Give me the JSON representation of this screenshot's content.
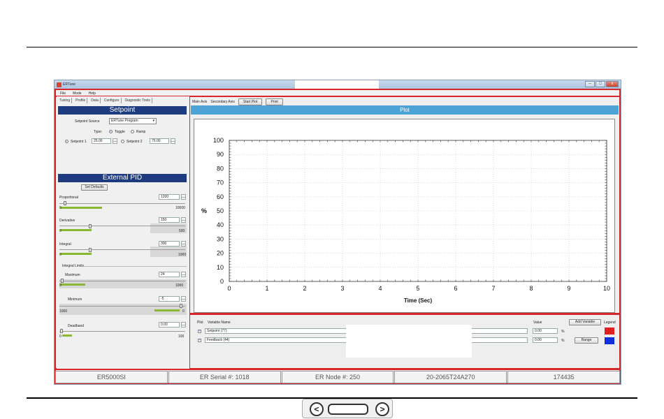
{
  "window": {
    "title": "ERTune",
    "min": "–",
    "max": "□",
    "close": "x"
  },
  "menu": [
    "File",
    "Mode",
    "Help"
  ],
  "tabs": [
    "Tuning",
    "Profile",
    "Data",
    "Configure",
    "Diagnostic Tools"
  ],
  "setpoint": {
    "heading": "Setpoint",
    "source_label": "Setpoint Source",
    "source_value": "ERTune Program",
    "type_label": "Type:",
    "type_options": [
      "Toggle",
      "Ramp"
    ],
    "sp1_label": "Setpoint 1",
    "sp1_value": "25.00",
    "sp2_label": "Setpoint 2",
    "sp2_value": "75.00"
  },
  "external_pid": {
    "heading": "External PID",
    "set_defaults": "Set Defaults",
    "proportional": {
      "label": "Proportional",
      "value": "1200",
      "min": "0",
      "max": "10000",
      "level": 0.12
    },
    "derivative": {
      "label": "Derivative",
      "value": "150",
      "min": "0",
      "max": "500",
      "level": 0.3
    },
    "integral": {
      "label": "Integral",
      "value": "300",
      "min": "0",
      "max": "1000",
      "level": 0.3
    },
    "integral_limits_label": "Integral Limits",
    "maximum": {
      "label": "Maximum",
      "value": "24",
      "min": "0",
      "max": "1000",
      "level": 0.024
    },
    "minimum": {
      "label": "Minimum",
      "value": "-5",
      "min": "1000",
      "max": "0",
      "level": 0.995
    },
    "deadband": {
      "label": "Deadband",
      "value": "0.00",
      "min": "0",
      "max": "100",
      "level": 0.0
    }
  },
  "toolbar": {
    "main_axis": "Main Axis",
    "secondary_axis": "Secondary Axis",
    "start_plot": "Start Plot",
    "print": "Print"
  },
  "plot_header": "Plot",
  "chart_data": {
    "type": "line",
    "xlabel": "Time (Sec)",
    "ylabel": "%",
    "xlim": [
      0,
      10
    ],
    "ylim": [
      0,
      100
    ],
    "xticks": [
      0,
      1,
      2,
      3,
      4,
      5,
      6,
      7,
      8,
      9,
      10
    ],
    "yticks": [
      0,
      10,
      20,
      30,
      40,
      50,
      60,
      70,
      80,
      90,
      100
    ],
    "grid": true,
    "series": []
  },
  "legend_table": {
    "col_plot": "Plot",
    "col_variable": "Variable Name",
    "col_value": "Value",
    "add_variable": "Add Variable",
    "col_legend": "Legend",
    "range": "Range",
    "rows": [
      {
        "name": "Setpoint (77)",
        "value": "0.00",
        "unit": "%",
        "color": "#e02020"
      },
      {
        "name": "Feedback (44)",
        "value": "0.00",
        "unit": "%",
        "color": "#1030e0"
      }
    ]
  },
  "status": [
    "ER5000SI",
    "ER Serial #: 1018",
    "ER Node #: 250",
    "20-2065T24A270",
    "174435"
  ],
  "nav": {
    "prev": "<",
    "next": ">"
  }
}
